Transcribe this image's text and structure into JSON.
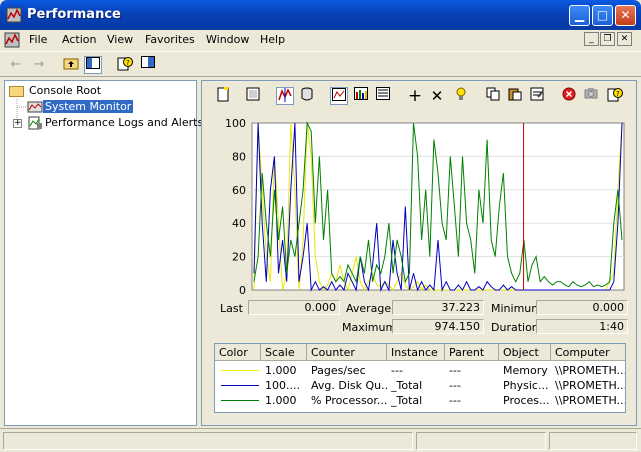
{
  "window": {
    "title": "Performance"
  },
  "menu": [
    "File",
    "Action",
    "View",
    "Favorites",
    "Window",
    "Help"
  ],
  "tree": {
    "root": "Console Root",
    "items": [
      {
        "label": "System Monitor",
        "selected": true
      },
      {
        "label": "Performance Logs and Alerts",
        "selected": false
      }
    ]
  },
  "stats": {
    "last_label": "Last",
    "last": "0.000",
    "average_label": "Average",
    "average": "37.223",
    "minimum_label": "Minimum",
    "minimum": "0.000",
    "maximum_label": "Maximum",
    "maximum": "974.150",
    "duration_label": "Duration",
    "duration": "1:40"
  },
  "legend": {
    "headers": [
      "Color",
      "Scale",
      "Counter",
      "Instance",
      "Parent",
      "Object",
      "Computer"
    ],
    "rows": [
      {
        "color": "#f0f000",
        "scale": "1.000",
        "counter": "Pages/sec",
        "instance": "---",
        "parent": "---",
        "object": "Memory",
        "computer": "\\\\PROMETH..."
      },
      {
        "color": "#0000c0",
        "scale": "100....",
        "counter": "Avg. Disk Qu...",
        "instance": "_Total",
        "parent": "---",
        "object": "Physic...",
        "computer": "\\\\PROMETH..."
      },
      {
        "color": "#008000",
        "scale": "1.000",
        "counter": "% Processor...",
        "instance": "_Total",
        "parent": "---",
        "object": "Proces...",
        "computer": "\\\\PROMETH..."
      }
    ]
  },
  "chart_data": {
    "type": "line",
    "ylim": [
      0,
      100
    ],
    "yticks": [
      "100",
      "80",
      "60",
      "40",
      "20",
      "0"
    ],
    "cursor_position": 0.73,
    "series": [
      {
        "color": "#e8e800",
        "values": [
          0,
          100,
          60,
          20,
          5,
          80,
          40,
          0,
          10,
          100,
          60,
          0,
          30,
          100,
          80,
          20,
          5,
          0,
          3,
          10,
          5,
          15,
          5,
          0,
          10,
          20,
          5,
          0,
          5,
          10,
          3,
          2,
          5,
          3,
          0,
          5,
          10,
          3,
          0,
          2,
          5,
          0,
          3,
          0,
          0,
          0,
          0,
          0,
          0,
          0,
          0,
          0,
          0,
          0,
          0,
          0,
          0,
          0,
          0,
          0,
          0,
          0,
          0,
          0,
          0,
          0,
          0,
          0,
          0,
          0,
          0,
          0,
          0,
          0,
          0,
          0,
          0,
          0,
          0,
          0,
          0,
          0,
          0,
          0,
          0,
          0,
          0,
          5,
          10,
          60,
          100
        ]
      },
      {
        "color": "#0000c0",
        "values": [
          10,
          100,
          40,
          5,
          60,
          80,
          10,
          30,
          5,
          60,
          100,
          5,
          20,
          40,
          0,
          5,
          0,
          2,
          0,
          5,
          0,
          3,
          0,
          10,
          5,
          0,
          20,
          5,
          0,
          15,
          40,
          0,
          5,
          0,
          30,
          10,
          0,
          50,
          0,
          10,
          0,
          5,
          0,
          3,
          0,
          30,
          0,
          5,
          0,
          0,
          3,
          0,
          5,
          0,
          0,
          2,
          0,
          5,
          2,
          0,
          0,
          3,
          0,
          2,
          0,
          0,
          0,
          0,
          0,
          0,
          0,
          0,
          0,
          0,
          0,
          0,
          0,
          0,
          0,
          0,
          0,
          0,
          0,
          0,
          0,
          0,
          0,
          0,
          5,
          40,
          100
        ]
      },
      {
        "color": "#008000",
        "values": [
          5,
          20,
          70,
          40,
          20,
          60,
          30,
          50,
          10,
          30,
          20,
          40,
          60,
          100,
          95,
          40,
          80,
          30,
          60,
          10,
          5,
          8,
          5,
          15,
          10,
          5,
          20,
          10,
          30,
          5,
          15,
          10,
          20,
          40,
          10,
          30,
          20,
          5,
          10,
          100,
          80,
          30,
          60,
          20,
          90,
          70,
          40,
          30,
          80,
          50,
          20,
          80,
          40,
          30,
          10,
          60,
          40,
          90,
          30,
          20,
          50,
          70,
          20,
          10,
          5,
          10,
          30,
          5,
          15,
          20,
          5,
          8,
          5,
          3,
          5,
          5,
          3,
          2,
          5,
          3,
          2,
          3,
          5,
          2,
          3,
          2,
          3,
          5,
          40,
          60,
          30
        ]
      }
    ]
  }
}
